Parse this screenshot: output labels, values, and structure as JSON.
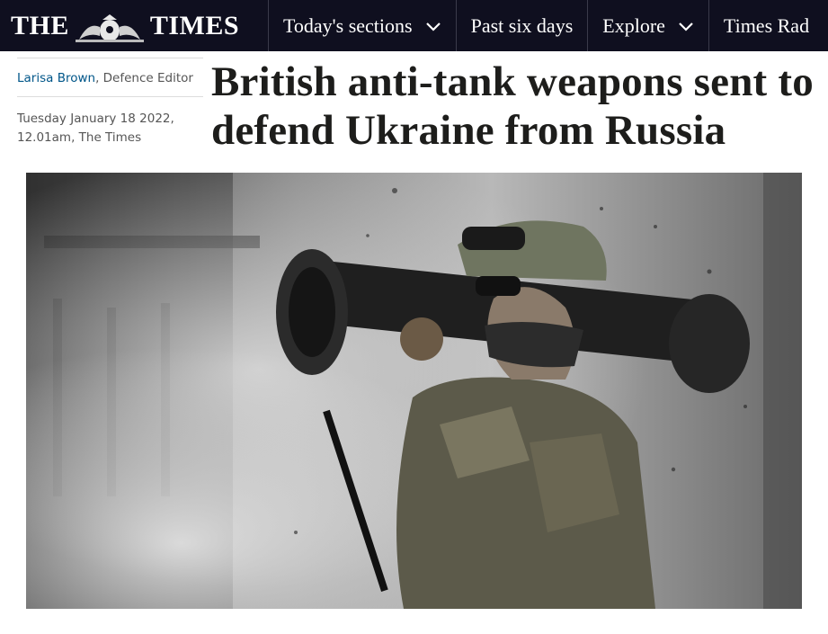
{
  "nav": {
    "logo_left": "THE",
    "logo_right": "TIMES",
    "items": [
      {
        "label": "Today's sections",
        "icon": "chevron-down-icon"
      },
      {
        "label": "Past six days"
      },
      {
        "label": "Explore",
        "icon": "chevron-down-icon"
      },
      {
        "label": "Times Rad"
      }
    ]
  },
  "article": {
    "author_name": "Larisa Brown",
    "author_role": ", Defence Editor",
    "date_line1": "Tuesday January 18 2022,",
    "date_line2": "12.01am, The Times",
    "headline": "British anti-tank weapons sent to defend Ukraine from Russia"
  },
  "hero_image": {
    "subject": "soldier-with-anti-tank-launcher-photo"
  },
  "colors": {
    "nav_bg": "#0f0f1f",
    "author_link": "#005689",
    "headline": "#1d1d1b"
  }
}
